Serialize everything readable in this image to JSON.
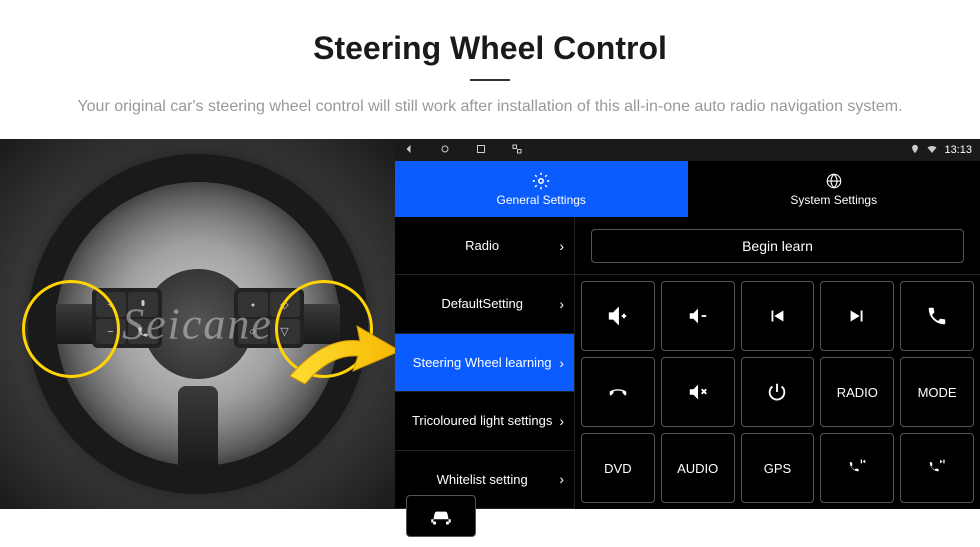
{
  "header": {
    "title": "Steering Wheel Control",
    "subtitle": "Your original car's steering wheel control will still work after installation of this all-in-one auto radio navigation system."
  },
  "watermark": "Seicane",
  "status_bar": {
    "time": "13:13"
  },
  "tabs": {
    "general": "General Settings",
    "system": "System Settings"
  },
  "settings_list": [
    "Radio",
    "DefaultSetting",
    "Steering Wheel learning",
    "Tricoloured light settings",
    "Whitelist setting"
  ],
  "learn_panel": {
    "begin": "Begin learn",
    "buttons": {
      "vol_up": "vol-up",
      "vol_down": "vol-down",
      "prev": "prev-track",
      "next": "next-track",
      "call": "call",
      "hangup": "hangup",
      "mute": "mute",
      "power": "power",
      "radio": "RADIO",
      "mode": "MODE",
      "dvd": "DVD",
      "audio": "AUDIO",
      "gps": "GPS",
      "call_prev": "call-prev",
      "call_next": "call-next",
      "car": "car"
    }
  }
}
